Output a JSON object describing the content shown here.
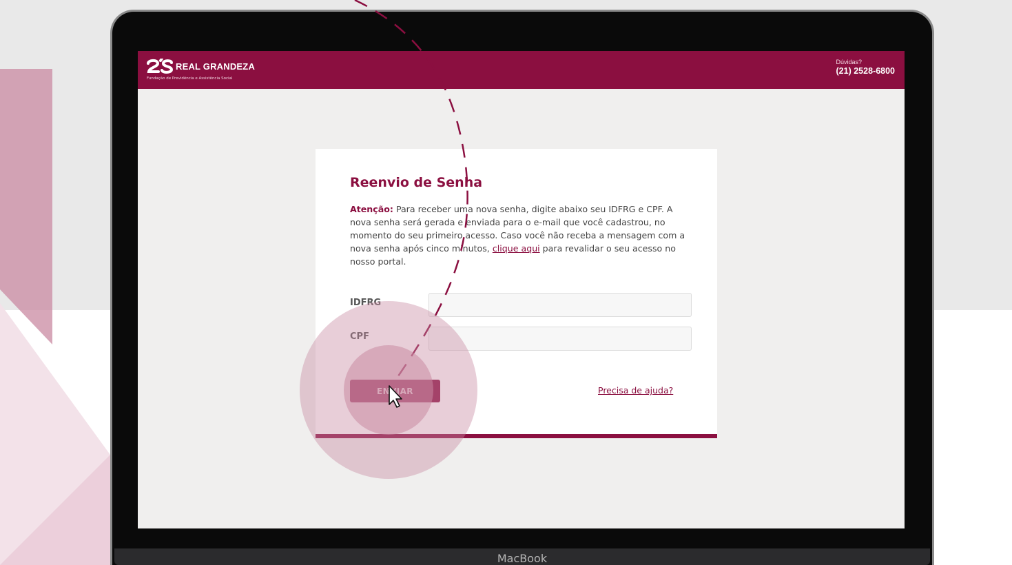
{
  "header": {
    "logo_name": "REAL GRANDEZA",
    "logo_subtitle": "Fundação de Previdência e Assistência Social",
    "help_label": "Dúvidas?",
    "help_phone": "(21) 2528-6800"
  },
  "form": {
    "title": "Reenvio de Senha",
    "attention_label": "Atenção:",
    "message_before_link": " Para receber uma nova senha, digite abaixo seu IDFRG e CPF. A nova senha será gerada e enviada para o e-mail que você cadastrou, no momento do seu primeiro acesso. Caso você não receba a mensagem com a nova senha após cinco minutos, ",
    "link_text": "clique aqui",
    "message_after_link": " para revalidar o seu acesso no nosso portal.",
    "idfrg_label": "IDFRG",
    "idfrg_value": "",
    "cpf_label": "CPF",
    "cpf_value": "",
    "submit_label": "ENVIAR",
    "help_link": "Precisa de ajuda?"
  },
  "device": {
    "brand": "MacBook"
  },
  "colors": {
    "brand": "#8b0f40",
    "highlight": "#c98aa2"
  },
  "icons": [
    "logo-mark-icon",
    "cursor-icon",
    "click-highlight-icon"
  ]
}
